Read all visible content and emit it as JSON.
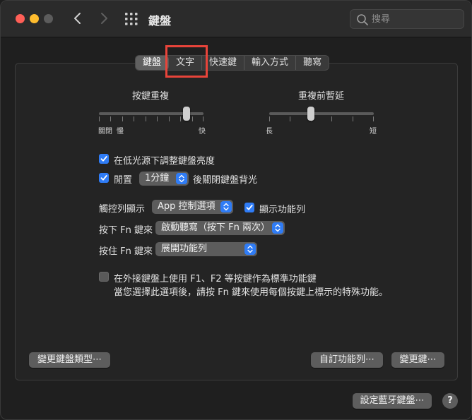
{
  "window": {
    "title": "鍵盤",
    "search_placeholder": "搜尋"
  },
  "tabs": [
    {
      "label": "鍵盤",
      "active": true
    },
    {
      "label": "文字",
      "active": false,
      "highlighted": true
    },
    {
      "label": "快速鍵",
      "active": false
    },
    {
      "label": "輸入方式",
      "active": false
    },
    {
      "label": "聽寫",
      "active": false
    }
  ],
  "key_repeat": {
    "title": "按鍵重複",
    "left_labels": [
      "關閉",
      "慢"
    ],
    "right_label": "快"
  },
  "delay": {
    "title": "重複前暫延",
    "left_label": "長",
    "right_label": "短"
  },
  "options": {
    "adjust_brightness": {
      "label": "在低光源下調整鍵盤亮度",
      "checked": true
    },
    "idle": {
      "label_before": "閒置",
      "value": "1分鐘",
      "label_after": "後關閉鍵盤背光",
      "checked": true
    }
  },
  "touch_bar": {
    "label": "觸控列顯示",
    "value": "App 控制選項",
    "show_strip_label": "顯示功能列",
    "show_strip_checked": true
  },
  "fn_press": {
    "label": "按下 Fn 鍵來",
    "value": "啟動聽寫（按下 Fn 兩次）"
  },
  "fn_hold": {
    "label": "按住 Fn 鍵來",
    "value": "展開功能列"
  },
  "fkeys": {
    "label": "在外接鍵盤上使用 F1、F2 等按鍵作為標準功能鍵",
    "note": "當您選擇此選項後，請按 Fn 鍵來使用每個按鍵上標示的特殊功能。",
    "checked": false
  },
  "buttons": {
    "change_keyboard_type": "變更鍵盤類型⋯",
    "customize_strip": "自訂功能列⋯",
    "modifier_keys": "變更鍵⋯",
    "bluetooth_keyboard": "設定藍牙鍵盤⋯",
    "help": "?"
  },
  "colors": {
    "accent": "#2f7cf6",
    "highlight_box": "#e8443a"
  }
}
